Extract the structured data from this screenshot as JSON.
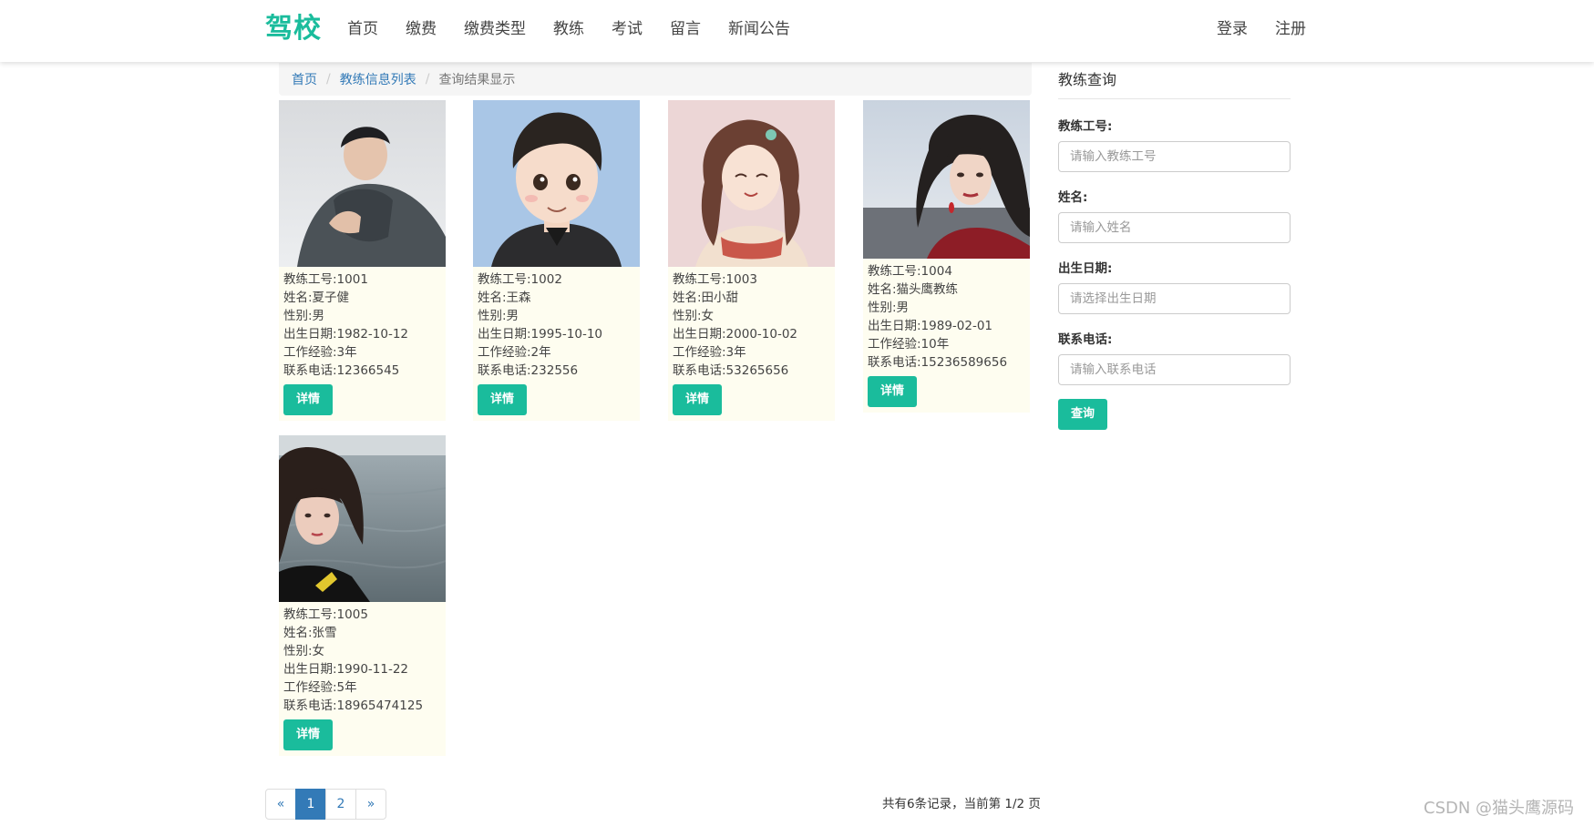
{
  "nav": {
    "brand": "驾校",
    "items": [
      "首页",
      "缴费",
      "缴费类型",
      "教练",
      "考试",
      "留言",
      "新闻公告"
    ],
    "login": "登录",
    "register": "注册"
  },
  "breadcrumb": {
    "home": "首页",
    "list": "教练信息列表",
    "current": "查询结果显示"
  },
  "coaches": [
    {
      "id": "教练工号:1001",
      "name": "姓名:夏子健",
      "gender": "性别:男",
      "birth": "出生日期:1982-10-12",
      "exp": "工作经验:3年",
      "phone": "联系电话:12366545",
      "detail": "详情"
    },
    {
      "id": "教练工号:1002",
      "name": "姓名:王森",
      "gender": "性别:男",
      "birth": "出生日期:1995-10-10",
      "exp": "工作经验:2年",
      "phone": "联系电话:232556",
      "detail": "详情"
    },
    {
      "id": "教练工号:1003",
      "name": "姓名:田小甜",
      "gender": "性别:女",
      "birth": "出生日期:2000-10-02",
      "exp": "工作经验:3年",
      "phone": "联系电话:53265656",
      "detail": "详情"
    },
    {
      "id": "教练工号:1004",
      "name": "姓名:猫头鹰教练",
      "gender": "性别:男",
      "birth": "出生日期:1989-02-01",
      "exp": "工作经验:10年",
      "phone": "联系电话:15236589656",
      "detail": "详情"
    },
    {
      "id": "教练工号:1005",
      "name": "姓名:张雪",
      "gender": "性别:女",
      "birth": "出生日期:1990-11-22",
      "exp": "工作经验:5年",
      "phone": "联系电话:18965474125",
      "detail": "详情"
    }
  ],
  "search": {
    "title": "教练查询",
    "id_label": "教练工号:",
    "id_placeholder": "请输入教练工号",
    "name_label": "姓名:",
    "name_placeholder": "请输入姓名",
    "birth_label": "出生日期:",
    "birth_placeholder": "请选择出生日期",
    "phone_label": "联系电话:",
    "phone_placeholder": "请输入联系电话",
    "submit": "查询"
  },
  "pagination": {
    "prev": "«",
    "pages": [
      "1",
      "2"
    ],
    "next": "»",
    "summary": "共有6条记录，当前第 1/2 页"
  },
  "watermark": "CSDN @猫头鹰源码",
  "colors": {
    "accent": "#1abc9c",
    "link": "#337ab7",
    "card_bg": "#fefdf0"
  }
}
